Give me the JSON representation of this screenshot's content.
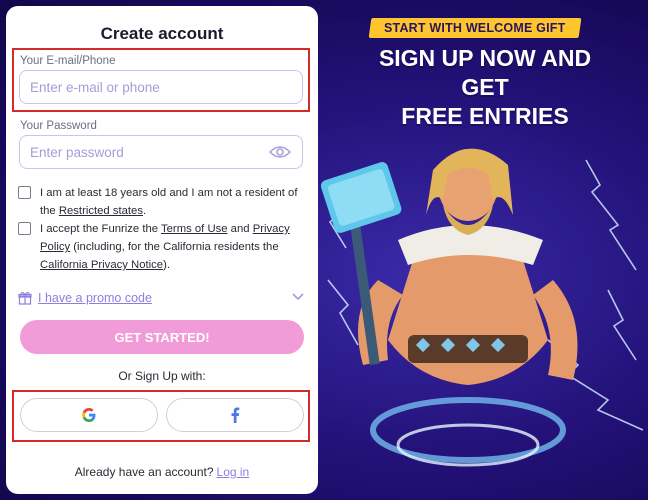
{
  "promo": {
    "badge": "START WITH WELCOME GIFT",
    "headline_line1": "SIGN UP NOW AND",
    "headline_line2": "GET",
    "headline_line3": "FREE ENTRIES",
    "colors": {
      "badge": "#ffc52e",
      "panel": "#24127a"
    }
  },
  "form": {
    "title": "Create account",
    "email": {
      "label": "Your E-mail/Phone",
      "placeholder": "Enter e-mail or phone",
      "value": ""
    },
    "password": {
      "label": "Your Password",
      "placeholder": "Enter password",
      "value": ""
    },
    "age_check": {
      "text_before": "I am at least 18 years old and I am not a resident of the ",
      "link": "Restricted states",
      "text_after": "."
    },
    "terms_check": {
      "text_1": "I accept the Funrize the ",
      "link_terms": "Terms of Use",
      "text_2": " and ",
      "link_privacy": "Privacy Policy",
      "text_3": " (including, for the California residents the ",
      "link_california": "California Privacy Notice",
      "text_4": ")."
    },
    "promo_code_label": "I have a promo code",
    "submit_label": "GET STARTED!",
    "alt_signup_label": "Or Sign Up with:",
    "login_prompt": "Already have an account?",
    "login_link": "Log in",
    "colors": {
      "submit": "#f29bd9",
      "link": "#8c7fe0",
      "highlight": "#d62a2a"
    }
  }
}
